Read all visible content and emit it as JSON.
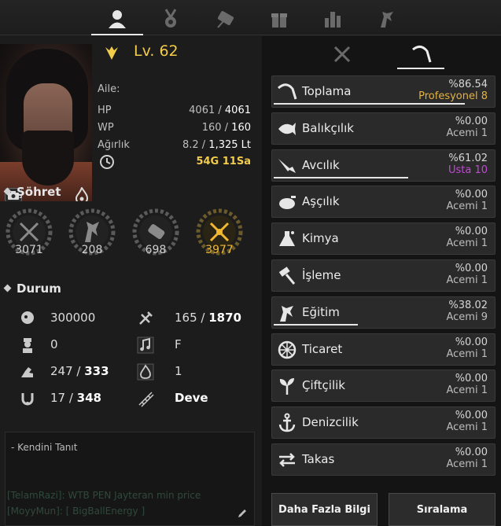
{
  "top_tabs": [
    {
      "name": "character-tab",
      "active": true
    },
    {
      "name": "medal-tab",
      "active": false
    },
    {
      "name": "scroll-tab",
      "active": false
    },
    {
      "name": "gift-tab",
      "active": false
    },
    {
      "name": "stats-tab",
      "active": false
    },
    {
      "name": "horse-tab",
      "active": false
    }
  ],
  "profile": {
    "level_label": "Lv.",
    "level": "62",
    "family_label": "Aile:",
    "family_value": "",
    "hp_label": "HP",
    "hp_current": "4061",
    "hp_max": "4061",
    "wp_label": "WP",
    "wp_current": "160",
    "wp_max": "160",
    "weight_label": "Ağırlık",
    "weight_current": "8.2",
    "weight_max": "1,325 Lt",
    "time_g": "54G",
    "time_sa": "11Sa"
  },
  "fame": {
    "title": "Şöhret",
    "items": [
      {
        "icon": "swords-icon",
        "value": "3071"
      },
      {
        "icon": "horse-head-icon",
        "value": "208"
      },
      {
        "icon": "scroll-icon",
        "value": "698"
      },
      {
        "icon": "crossed-tools-icon",
        "value": "3977"
      }
    ]
  },
  "status": {
    "title": "Durum",
    "items": [
      {
        "icon": "head-icon",
        "value": "300000"
      },
      {
        "icon": "hammer-axe-icon",
        "current": "165",
        "max": "1870"
      },
      {
        "icon": "soldier-icon",
        "value": "0"
      },
      {
        "icon": "music-note-icon",
        "value": "F"
      },
      {
        "icon": "flexed-arm-icon",
        "current": "247",
        "max": "333"
      },
      {
        "icon": "energy-flame-icon",
        "value": "1"
      },
      {
        "icon": "horseshoe-icon",
        "current": "17",
        "max": "348"
      },
      {
        "icon": "ladder-icon",
        "value": "Deve"
      }
    ]
  },
  "intro": {
    "label": "- Kendini Tanıt",
    "chat_lines": [
      "[TelamRazi]: WTB PEN Jayteran min price",
      "[MoyyMun]: [ BigBallEnergy ]"
    ]
  },
  "right_tabs": [
    {
      "name": "combat-tab",
      "active": false
    },
    {
      "name": "life-tab",
      "active": true
    }
  ],
  "life_skills": [
    {
      "icon": "sickle-icon",
      "name": "Toplama",
      "pct": "%86.54",
      "rank": "Profesyonel 8",
      "rank_color": "#e3b341",
      "progress": 0.8654,
      "show_bar": true
    },
    {
      "icon": "fish-icon",
      "name": "Balıkçılık",
      "pct": "%0.00",
      "rank": "Acemi 1",
      "rank_color": "#bdbdbd",
      "progress": 0,
      "show_bar": false
    },
    {
      "icon": "knife-icon",
      "name": "Avcılık",
      "pct": "%61.02",
      "rank": "Usta 10",
      "rank_color": "#c24ad6",
      "progress": 0.6102,
      "show_bar": true
    },
    {
      "icon": "cooking-pot-icon",
      "name": "Aşçılık",
      "pct": "%0.00",
      "rank": "Acemi 1",
      "rank_color": "#bdbdbd",
      "progress": 0,
      "show_bar": false
    },
    {
      "icon": "flask-icon",
      "name": "Kimya",
      "pct": "%0.00",
      "rank": "Acemi 1",
      "rank_color": "#bdbdbd",
      "progress": 0,
      "show_bar": false
    },
    {
      "icon": "hammer-icon",
      "name": "İşleme",
      "pct": "%0.00",
      "rank": "Acemi 1",
      "rank_color": "#bdbdbd",
      "progress": 0,
      "show_bar": false
    },
    {
      "icon": "horse-icon",
      "name": "Eğitim",
      "pct": "%38.02",
      "rank": "Acemi 9",
      "rank_color": "#bdbdbd",
      "progress": 0.3802,
      "show_bar": true
    },
    {
      "icon": "wheel-icon",
      "name": "Ticaret",
      "pct": "%0.00",
      "rank": "Acemi 1",
      "rank_color": "#bdbdbd",
      "progress": 0,
      "show_bar": false
    },
    {
      "icon": "sprout-icon",
      "name": "Çiftçilik",
      "pct": "%0.00",
      "rank": "Acemi 1",
      "rank_color": "#bdbdbd",
      "progress": 0,
      "show_bar": false
    },
    {
      "icon": "anchor-icon",
      "name": "Denizcilik",
      "pct": "%0.00",
      "rank": "Acemi 1",
      "rank_color": "#bdbdbd",
      "progress": 0,
      "show_bar": false
    },
    {
      "icon": "swap-arrows-icon",
      "name": "Takas",
      "pct": "%0.00",
      "rank": "Acemi 1",
      "rank_color": "#bdbdbd",
      "progress": 0,
      "show_bar": false
    }
  ],
  "buttons": {
    "more_info": "Daha Fazla Bilgi",
    "ranking": "Sıralama"
  },
  "colors": {
    "gold": "#f2cc4a",
    "background": "#1b1b1b",
    "row": "#2a2a2a"
  }
}
